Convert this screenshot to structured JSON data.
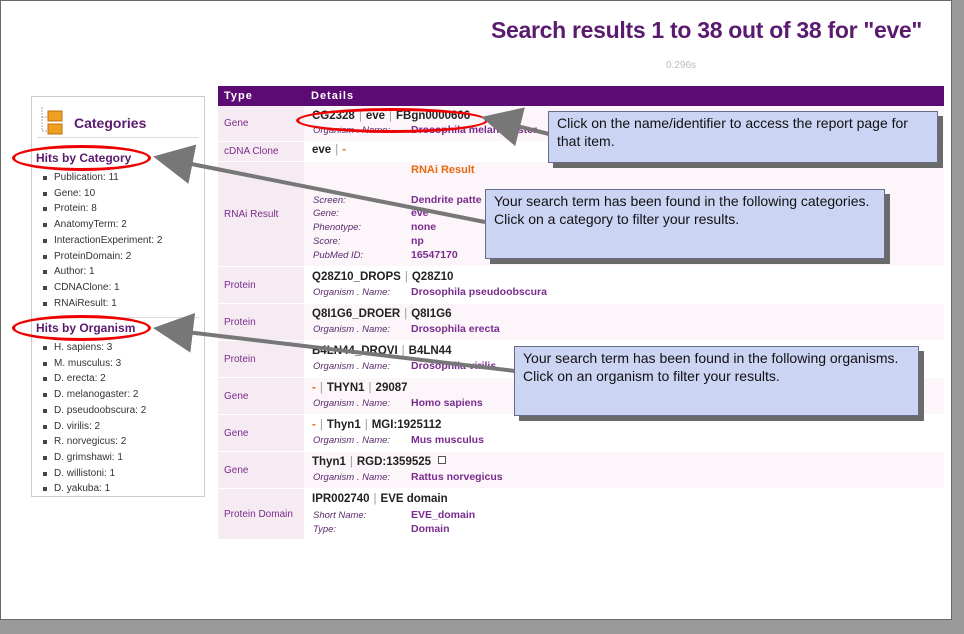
{
  "header": {
    "title": "Search results 1 to 38 out of 38 for \"eve\"",
    "time": "0.296s"
  },
  "sidebar": {
    "title": "Categories",
    "category_heading": "Hits by Category",
    "categories": [
      "Publication: 11",
      "Gene: 10",
      "Protein: 8",
      "AnatomyTerm: 2",
      "InteractionExperiment: 2",
      "ProteinDomain: 2",
      "Author: 1",
      "CDNAClone: 1",
      "RNAiResult: 1"
    ],
    "organism_heading": "Hits by Organism",
    "organisms": [
      "H. sapiens: 3",
      "M. musculus: 3",
      "D. erecta: 2",
      "D. melanogaster: 2",
      "D. pseudoobscura: 2",
      "D. virilis: 2",
      "R. norvegicus: 2",
      "D. grimshawi: 1",
      "D. willistoni: 1",
      "D. yakuba: 1"
    ]
  },
  "table": {
    "col_type": "Type",
    "col_details": "Details",
    "rows": {
      "r1": {
        "type": "Gene",
        "id1": "CG2328",
        "id2": "eve",
        "id3": "FBgn0000606",
        "l1": "Organism . Name:",
        "v1": "Drosophila melanogaster"
      },
      "r2": {
        "type": "cDNA Clone",
        "id1": "eve",
        "id2": "-"
      },
      "r3": {
        "type": "RNAi Result",
        "heading": "RNAi Result",
        "l1": "Screen:",
        "v1": "Dendrite patte",
        "l2": "Gene:",
        "v2": "eve",
        "l3": "Phenotype:",
        "v3": "none",
        "l4": "Score:",
        "v4": "np",
        "l5": "PubMed ID:",
        "v5": "16547170"
      },
      "r4": {
        "type": "Protein",
        "id1": "Q28Z10_DROPS",
        "id2": "Q28Z10",
        "l1": "Organism . Name:",
        "v1": "Drosophila pseudoobscura"
      },
      "r5": {
        "type": "Protein",
        "id1": "Q8I1G6_DROER",
        "id2": "Q8I1G6",
        "l1": "Organism . Name:",
        "v1": "Drosophila erecta"
      },
      "r6": {
        "type": "Protein",
        "id1": "B4LN44_DROVI",
        "id2": "B4LN44",
        "l1": "Organism . Name:",
        "v1": "Drosophila virilis"
      },
      "r7": {
        "type": "Gene",
        "id0": "-",
        "id1": "THYN1",
        "id2": "29087",
        "l1": "Organism . Name:",
        "v1": "Homo sapiens"
      },
      "r8": {
        "type": "Gene",
        "id0": "-",
        "id1": "Thyn1",
        "id2": "MGI:1925112",
        "l1": "Organism . Name:",
        "v1": "Mus musculus"
      },
      "r9": {
        "type": "Gene",
        "id0": "-",
        "id1": "Thyn1",
        "id2": "RGD:1359525",
        "l1": "Organism . Name:",
        "v1": "Rattus norvegicus"
      },
      "r10": {
        "type": "Protein Domain",
        "id1": "IPR002740",
        "id2": "EVE domain",
        "l1": "Short Name:",
        "v1": "EVE_domain",
        "l2": "Type:",
        "v2": "Domain"
      }
    }
  },
  "callouts": {
    "c1": "Click on the name/identifier to access the report page for that item.",
    "c2": "Your search term has been found in the following categories.  Click on a category to filter your results.",
    "c3": "Your search term has been found in the following organisms.  Click on an organism to filter your results."
  },
  "colors": {
    "brand": "#5c0a74",
    "accent": "#e86a10",
    "highlight": "#e00000",
    "callout_bg": "#ccd4f4"
  },
  "icons": [
    "folder-icon",
    "external-link-icon",
    "arrow-icon"
  ]
}
